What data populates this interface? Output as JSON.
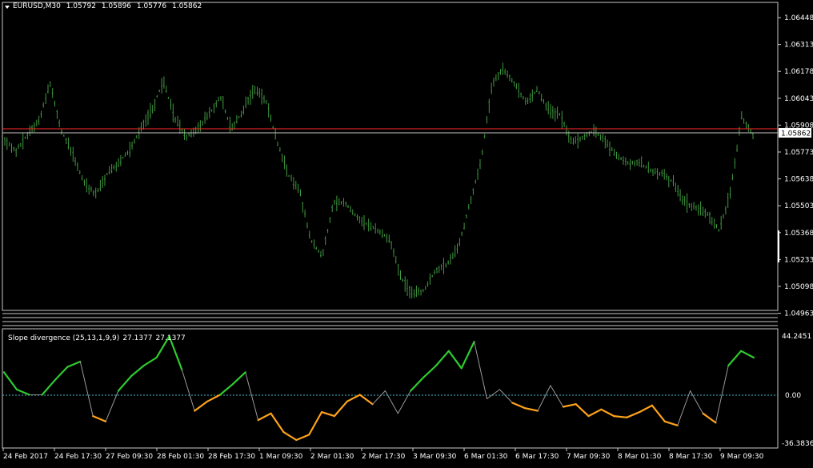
{
  "chart": {
    "symbol": "EURUSD,M30",
    "ohlc": [
      "1.05792",
      "1.05896",
      "1.05776",
      "1.05862"
    ],
    "current_price": "1.05862",
    "price_axis": [
      "1.06448",
      "1.06313",
      "1.06178",
      "1.06043",
      "1.05908",
      "1.05773",
      "1.05638",
      "1.05503",
      "1.05368",
      "1.05233",
      "1.05098",
      "1.04963"
    ],
    "time_axis": [
      "24 Feb 2017",
      "24 Feb 17:30",
      "27 Feb 09:30",
      "28 Feb 01:30",
      "28 Feb 17:30",
      "1 Mar 09:30",
      "2 Mar 01:30",
      "2 Mar 17:30",
      "3 Mar 09:30",
      "6 Mar 01:30",
      "6 Mar 17:30",
      "7 Mar 09:30",
      "8 Mar 01:30",
      "8 Mar 17:30",
      "9 Mar 09:30"
    ]
  },
  "indicator": {
    "name": "Slope divergence (25,13,1,9,9)",
    "value1": "27.1377",
    "value2": "27.1377",
    "axis": [
      "44.2451",
      "0.00",
      "-36.3836"
    ]
  },
  "colors": {
    "candles": "#3f9a3f",
    "bid_line": "#c8c8c8",
    "red_line": "#ff2a2a",
    "slope_up": "#2ecc2e",
    "slope_down": "#ffa31a",
    "zero_line": "#45b8c8"
  },
  "chart_data": [
    {
      "type": "line",
      "series": [
        {
          "values": [
            1.0583,
            1.0578,
            1.0586,
            1.0593,
            1.0612,
            1.0588,
            1.0576,
            1.0562,
            1.0556,
            1.0566,
            1.0572,
            1.0578,
            1.0589,
            1.0599,
            1.0613,
            1.0594,
            1.0585,
            1.0589,
            1.0596,
            1.0605,
            1.0589,
            1.0598,
            1.0609,
            1.0604,
            1.0583,
            1.0566,
            1.0558,
            1.0533,
            1.0525,
            1.0552,
            1.0552,
            1.0545,
            1.0541,
            1.0538,
            1.0533,
            1.0514,
            1.0506,
            1.0508,
            1.0518,
            1.0521,
            1.0529,
            1.0551,
            1.0572,
            1.0612,
            1.0619,
            1.0611,
            1.0602,
            1.0609,
            1.0598,
            1.0596,
            1.0582,
            1.0585,
            1.0588,
            1.0583,
            1.0575,
            1.0572,
            1.0572,
            1.0568,
            1.0566,
            1.0562,
            1.0552,
            1.0549,
            1.0546,
            1.0538,
            1.0557,
            1.0595,
            1.0586
          ]
        }
      ],
      "ylim": [
        1.04963,
        1.06448
      ]
    },
    {
      "type": "line",
      "series": [
        {
          "values": [
            17,
            4,
            0,
            0,
            11,
            21,
            25,
            -16,
            -20,
            3,
            14,
            22,
            28,
            44,
            19,
            -12,
            -5,
            0,
            8,
            17,
            -19,
            -14,
            -28,
            -34,
            -30,
            -13,
            -16,
            -5,
            0,
            -7,
            3,
            -14,
            3,
            13,
            22,
            33,
            20,
            40,
            -3,
            4,
            -6,
            -10,
            -12,
            7,
            -9,
            -7,
            -16,
            -11,
            -16,
            -17,
            -13,
            -8,
            -20,
            -23,
            3,
            -14,
            -21,
            22,
            33,
            28
          ]
        }
      ],
      "ylim": [
        -36.3836,
        44.2451
      ]
    }
  ]
}
